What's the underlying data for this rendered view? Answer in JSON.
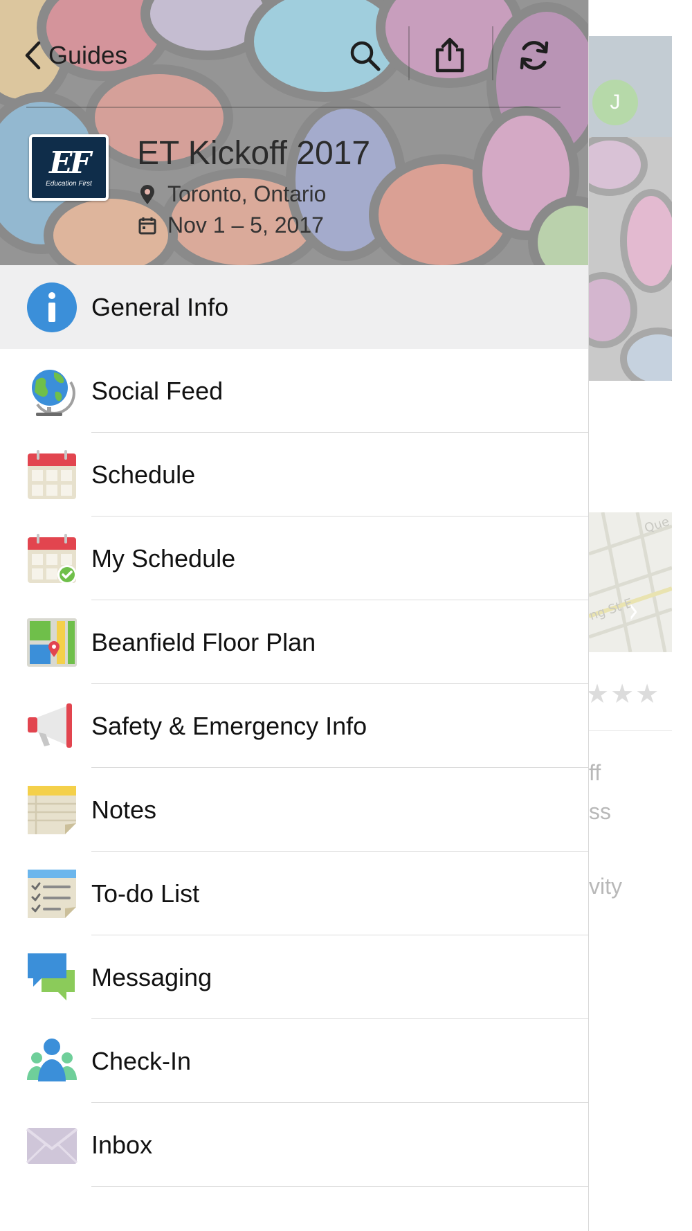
{
  "drawer": {
    "back_label": "Guides",
    "event": {
      "title": "ET Kickoff 2017",
      "location": "Toronto, Ontario",
      "dates": "Nov 1 – 5, 2017",
      "logo_text": "EF",
      "logo_subtext": "Education First"
    },
    "menu": [
      {
        "label": "General Info",
        "icon": "info-icon",
        "selected": true
      },
      {
        "label": "Social Feed",
        "icon": "globe-icon"
      },
      {
        "label": "Schedule",
        "icon": "calendar-icon"
      },
      {
        "label": "My Schedule",
        "icon": "calendar-check-icon"
      },
      {
        "label": "Beanfield Floor Plan",
        "icon": "map-icon"
      },
      {
        "label": "Safety & Emergency Info",
        "icon": "megaphone-icon"
      },
      {
        "label": "Notes",
        "icon": "notepad-icon"
      },
      {
        "label": "To-do List",
        "icon": "checklist-icon"
      },
      {
        "label": "Messaging",
        "icon": "chat-bubbles-icon"
      },
      {
        "label": "Check-In",
        "icon": "people-icon"
      },
      {
        "label": "Inbox",
        "icon": "envelope-icon"
      }
    ]
  },
  "background_screen": {
    "avatar_initial": "J",
    "map_labels": [
      "Que",
      "ng St E"
    ],
    "text_fragments": [
      "ff",
      "ss",
      "vity"
    ],
    "stars": "★★★"
  },
  "colors": {
    "selected_row": "#efeff0",
    "info_blue": "#3b8fd9",
    "calendar_red": "#e2454f",
    "check_green": "#6fbf4a"
  }
}
